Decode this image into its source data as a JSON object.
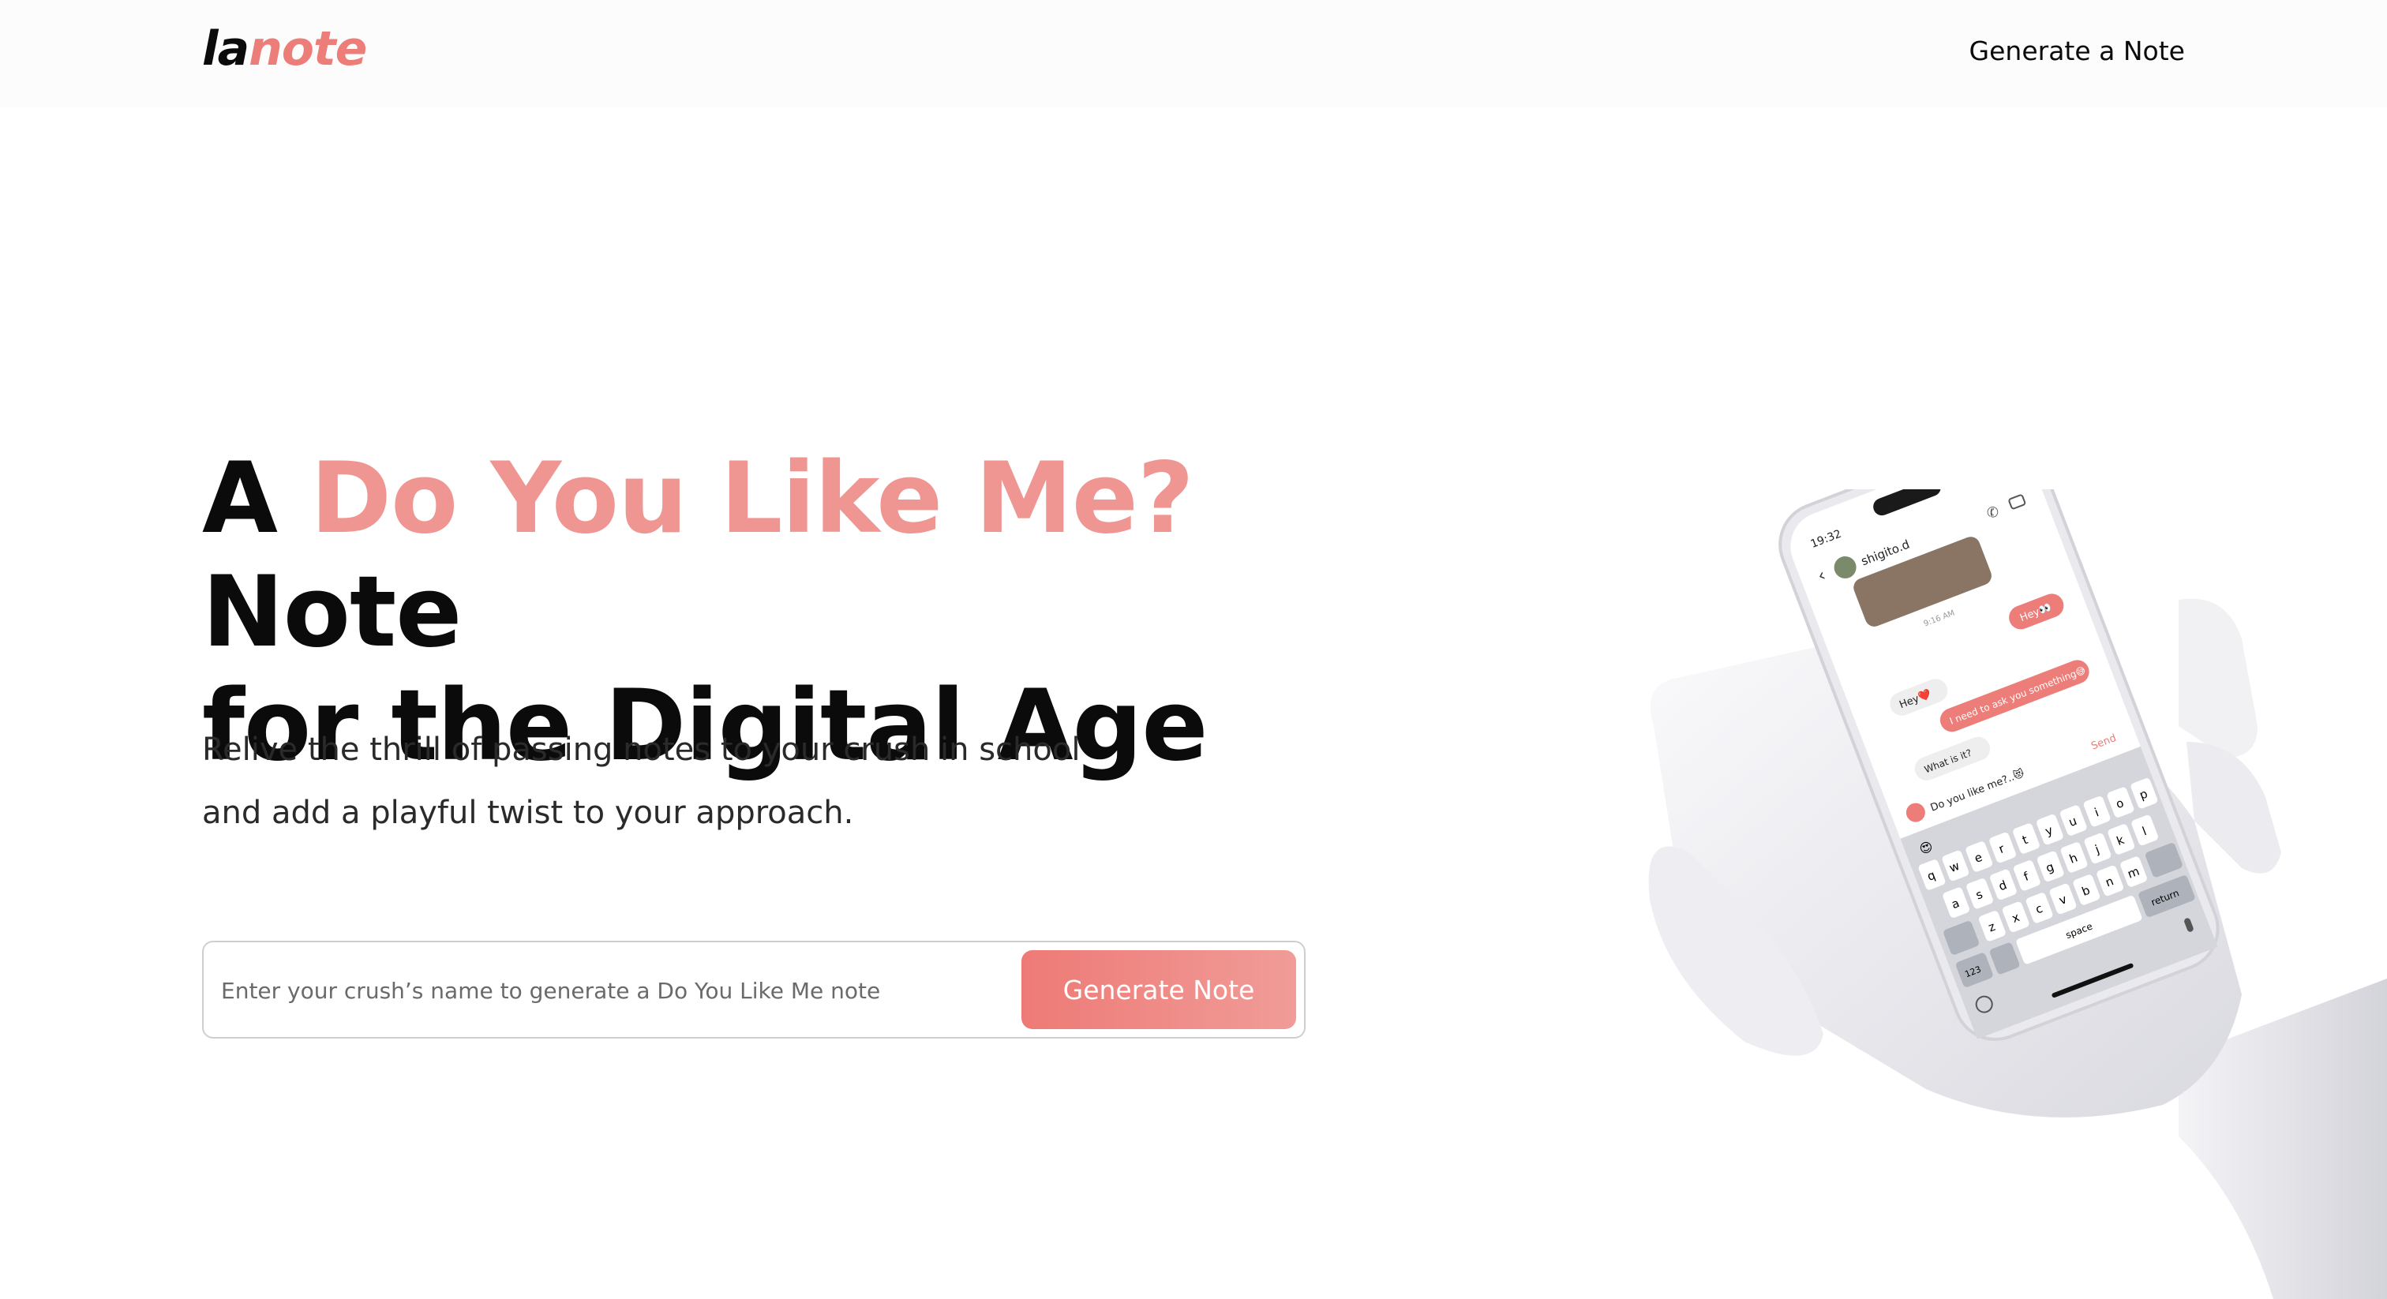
{
  "header": {
    "logo": {
      "part1": "la",
      "part2": "note"
    },
    "nav_link": "Generate a Note"
  },
  "hero": {
    "title_prefix": "A ",
    "title_accent": "Do You Like Me?",
    "title_line1_suffix": " Note",
    "title_line2": "for the Digital Age",
    "subtitle_line1": "Relive the thrill of passing notes to your crush in school",
    "subtitle_line2": "and add a playful twist to your approach."
  },
  "form": {
    "input_placeholder": "Enter your crush’s name to generate a Do You Like Me note",
    "input_value": "",
    "button_label": "Generate Note"
  },
  "phone": {
    "status_time": "19:32",
    "contact_name": "shigito.d",
    "msg_time": "9:16 AM",
    "messages": [
      {
        "from": "me",
        "text": "Hey👀"
      },
      {
        "from": "them",
        "text": "Hey❤️"
      },
      {
        "from": "me",
        "text": "I need to ask you something😅"
      },
      {
        "from": "them",
        "text": "What is it?"
      }
    ],
    "compose_text": "Do you like me?..😻",
    "send_label": "Send",
    "emoji_suggestion": "😍",
    "keyboard": {
      "row1": [
        "q",
        "w",
        "e",
        "r",
        "t",
        "y",
        "u",
        "i",
        "o",
        "p"
      ],
      "row2": [
        "a",
        "s",
        "d",
        "f",
        "g",
        "h",
        "j",
        "k",
        "l"
      ],
      "row3": [
        "z",
        "x",
        "c",
        "v",
        "b",
        "n",
        "m"
      ],
      "num_key": "123",
      "space_key": "space",
      "return_key": "return"
    }
  },
  "colors": {
    "accent": "#ef9692",
    "button_start": "#ee7a76",
    "button_end": "#f09c98",
    "text": "#0b0b0b"
  }
}
